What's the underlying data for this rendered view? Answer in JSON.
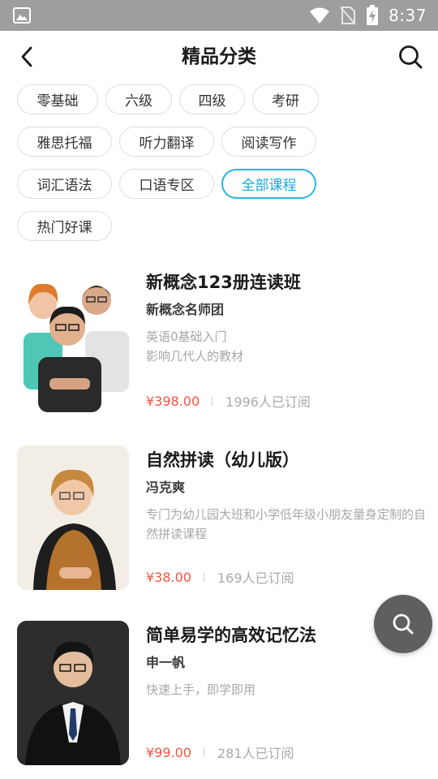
{
  "status_bar": {
    "time": "8:37",
    "icons": [
      "image-icon",
      "wifi-icon",
      "no-sim-icon",
      "battery-charging-icon"
    ]
  },
  "header": {
    "title": "精品分类",
    "back_icon": "back-arrow-icon",
    "search_icon": "search-icon"
  },
  "tags": {
    "rows": [
      [
        {
          "label": "零基础"
        },
        {
          "label": "六级"
        },
        {
          "label": "四级"
        },
        {
          "label": "考研"
        }
      ],
      [
        {
          "label": "雅思托福"
        },
        {
          "label": "听力翻译"
        },
        {
          "label": "阅读写作"
        }
      ],
      [
        {
          "label": "词汇语法"
        },
        {
          "label": "口语专区"
        },
        {
          "label": "全部课程",
          "active": true
        }
      ],
      [
        {
          "label": "热门好课"
        }
      ]
    ]
  },
  "courses": [
    {
      "title": "新概念123册连读班",
      "teacher": "新概念名师团",
      "desc": "英语0基础入门\n影响几代人的教材",
      "price": "¥398.00",
      "subscribers": "1996人已订阅"
    },
    {
      "title": "自然拼读（幼儿版）",
      "teacher": "冯克爽",
      "desc": "专门为幼儿园大班和小学低年级小朋友量身定制的自然拼读课程",
      "price": "¥38.00",
      "subscribers": "169人已订阅"
    },
    {
      "title": "简单易学的高效记忆法",
      "teacher": "申一帆",
      "desc": "快速上手，即学即用",
      "price": "¥99.00",
      "subscribers": "281人已订阅"
    }
  ],
  "floating_button": {
    "icon": "search-icon"
  },
  "colors": {
    "accent": "#27b6e0",
    "price": "#f1553f",
    "status_bar": "#9e9e9e"
  }
}
